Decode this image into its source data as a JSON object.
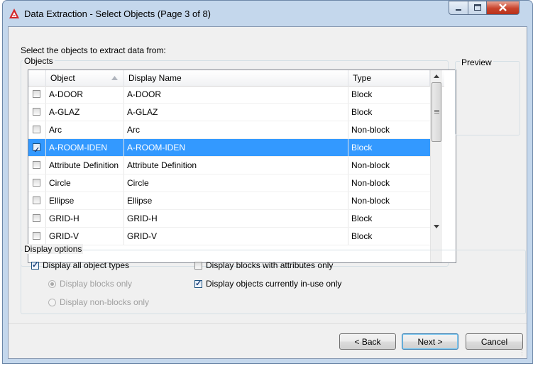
{
  "window": {
    "title": "Data Extraction - Select Objects (Page 3 of 8)"
  },
  "instruction": "Select the objects to extract data from:",
  "objects_group": {
    "legend": "Objects",
    "columns": {
      "object": "Object",
      "display_name": "Display Name",
      "type": "Type"
    },
    "rows": [
      {
        "object": "A-DOOR",
        "display_name": "A-DOOR",
        "type": "Block",
        "checked": false,
        "selected": false
      },
      {
        "object": "A-GLAZ",
        "display_name": "A-GLAZ",
        "type": "Block",
        "checked": false,
        "selected": false
      },
      {
        "object": "Arc",
        "display_name": "Arc",
        "type": "Non-block",
        "checked": false,
        "selected": false
      },
      {
        "object": "A-ROOM-IDEN",
        "display_name": "A-ROOM-IDEN",
        "type": "Block",
        "checked": true,
        "selected": true
      },
      {
        "object": "Attribute Definition",
        "display_name": "Attribute Definition",
        "type": "Non-block",
        "checked": false,
        "selected": false
      },
      {
        "object": "Circle",
        "display_name": "Circle",
        "type": "Non-block",
        "checked": false,
        "selected": false
      },
      {
        "object": "Ellipse",
        "display_name": "Ellipse",
        "type": "Non-block",
        "checked": false,
        "selected": false
      },
      {
        "object": "GRID-H",
        "display_name": "GRID-H",
        "type": "Block",
        "checked": false,
        "selected": false
      },
      {
        "object": "GRID-V",
        "display_name": "GRID-V",
        "type": "Block",
        "checked": false,
        "selected": false
      }
    ]
  },
  "preview": {
    "legend": "Preview"
  },
  "display_options": {
    "legend": "Display options",
    "all_types": {
      "label": "Display all object types",
      "checked": true
    },
    "blocks_only": {
      "label": "Display blocks only",
      "selected": true
    },
    "non_blocks_only": {
      "label": "Display non-blocks only",
      "selected": false
    },
    "attrs_only": {
      "label": "Display blocks with attributes only",
      "checked": false
    },
    "in_use_only": {
      "label": "Display objects currently in-use only",
      "checked": true
    }
  },
  "buttons": {
    "back": "< Back",
    "next": "Next >",
    "cancel": "Cancel"
  },
  "colors": {
    "selection": "#3399ff",
    "frame": "#c4d7ec",
    "close": "#c8432b"
  },
  "icons": [
    "autocad-icon",
    "minimize-icon",
    "maximize-icon",
    "close-icon",
    "sort-ascending-icon",
    "scroll-up-icon",
    "scroll-down-icon",
    "scroll-grip-icon",
    "resize-grip-icon"
  ]
}
